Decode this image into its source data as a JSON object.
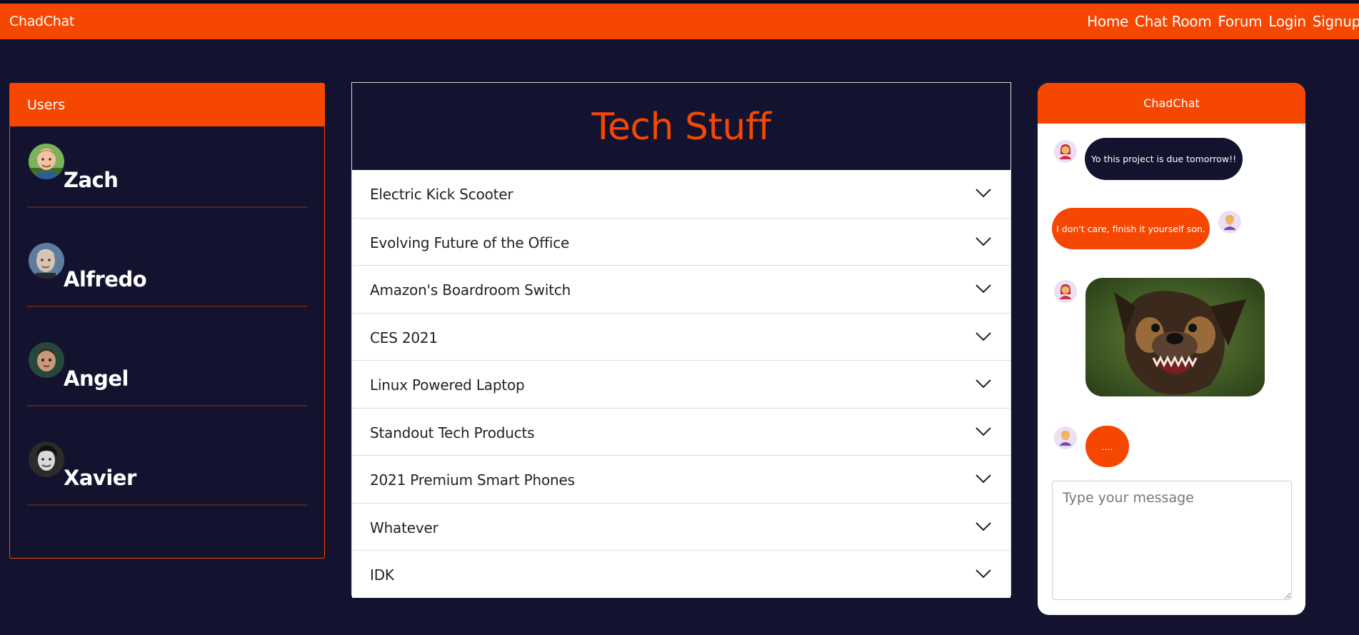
{
  "navbar": {
    "brand": "ChadChat",
    "links": [
      "Home",
      "Chat Room",
      "Forum",
      "Login",
      "Signup"
    ]
  },
  "users": {
    "header": "Users",
    "list": [
      {
        "name": "Zach"
      },
      {
        "name": "Alfredo"
      },
      {
        "name": "Angel"
      },
      {
        "name": "Xavier"
      }
    ]
  },
  "forum": {
    "title": "Tech Stuff",
    "topics": [
      "Electric Kick Scooter",
      "Evolving Future of the Office",
      "Amazon's Boardroom Switch",
      "CES 2021",
      "Linux Powered Laptop",
      "Standout Tech Products",
      "2021 Premium Smart Phones",
      "Whatever",
      "IDK"
    ]
  },
  "chat": {
    "title": "ChadChat",
    "messages": [
      {
        "text": "Yo this project is due tomorrow!!",
        "side": "left"
      },
      {
        "text": "I don't care, finish it yourself son.",
        "side": "right"
      },
      {
        "text": "....",
        "side": "left"
      }
    ],
    "input_placeholder": "Type your message"
  },
  "colors": {
    "accent": "#f54702",
    "background": "#13132f",
    "panel": "#ffffff"
  }
}
